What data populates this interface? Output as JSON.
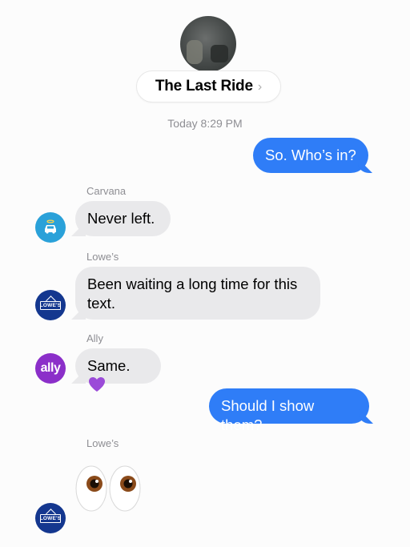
{
  "conversation": {
    "title": "The Last Ride",
    "chevron": "›",
    "timestamp_day": "Today",
    "timestamp_time": "8:29 PM"
  },
  "messages": [
    {
      "from": "me",
      "text": "So. Who’s in?"
    },
    {
      "from": "Carvana",
      "sender_label": "Carvana",
      "text": "Never left."
    },
    {
      "from": "Lowe’s",
      "sender_label": "Lowe’s",
      "text_line1": "Been waiting a long time for this",
      "text_line2": "text."
    },
    {
      "from": "Ally",
      "sender_label": "Ally",
      "text": "Same."
    },
    {
      "from": "me",
      "text": "Should I show them?"
    },
    {
      "from": "Lowe’s",
      "sender_label": "Lowe’s",
      "emoji": "eyes"
    }
  ],
  "avatars": {
    "carvana_icon": "car-with-halo-icon",
    "lowes_logo_text": "LOWE'S",
    "ally_logo_text": "ally"
  },
  "colors": {
    "outgoing_bubble": "#2f7df7",
    "incoming_bubble": "#e9e9eb",
    "carvana": "#2aa1d9",
    "lowes": "#14378f",
    "ally": "#8b2fc9",
    "heart": "#9b4bd8"
  }
}
